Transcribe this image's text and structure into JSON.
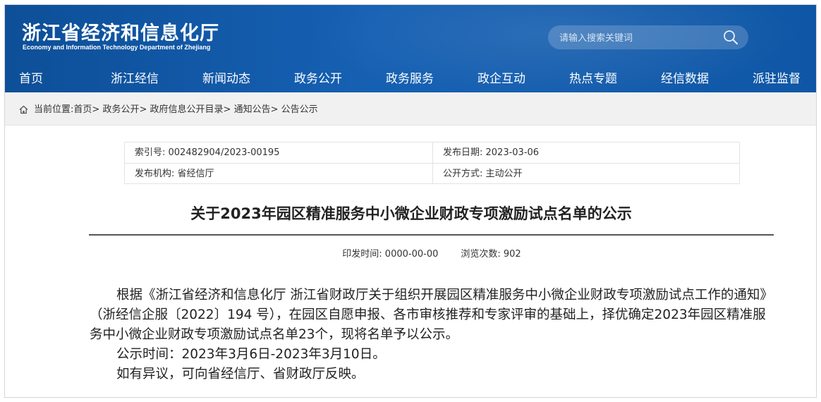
{
  "header": {
    "title": "浙江省经济和信息化厅",
    "subtitle": "Economy and Information Technology Department of Zhejiang",
    "search_placeholder": "请输入搜索关键词"
  },
  "nav": {
    "items": [
      "首页",
      "浙江经信",
      "新闻动态",
      "政务公开",
      "政务服务",
      "政企互动",
      "热点专题",
      "经信数据",
      "派驻监督"
    ],
    "active": "首页"
  },
  "breadcrumb": {
    "prefix": "当前位置:",
    "items": [
      "首页",
      "政务公开",
      "政府信息公开目录",
      "通知公告",
      "公告公示"
    ],
    "separator": ">"
  },
  "meta": {
    "index_no": "索引号: 002482904/2023-00195",
    "publish_date": "发布日期: 2023-03-06",
    "publisher": "发布机构: 省经信厅",
    "open_mode": "公开方式: 主动公开"
  },
  "article": {
    "title": "关于2023年园区精准服务中小微企业财政专项激励试点名单的公示",
    "print_time": "印发时间: 0000-00-00",
    "views": "浏览次数: 902",
    "paragraphs": [
      "根据《浙江省经济和信息化厅 浙江省财政厅关于组织开展园区精准服务中小微企业财政专项激励试点工作的通知》（浙经信企服〔2022〕194 号），在园区自愿申报、各市审核推荐和专家评审的基础上，择优确定2023年园区精准服务中小微企业财政专项激励试点名单23个，现将名单予以公示。",
      "公示时间：2023年3月6日-2023年3月10日。",
      "如有异议，可向省经信厅、省财政厅反映。"
    ]
  },
  "icons": {
    "search": "search-icon",
    "home": "home-icon"
  },
  "colors": {
    "header_blue": "#1660b3",
    "breadcrumb_bg": "#f1f1f1"
  }
}
